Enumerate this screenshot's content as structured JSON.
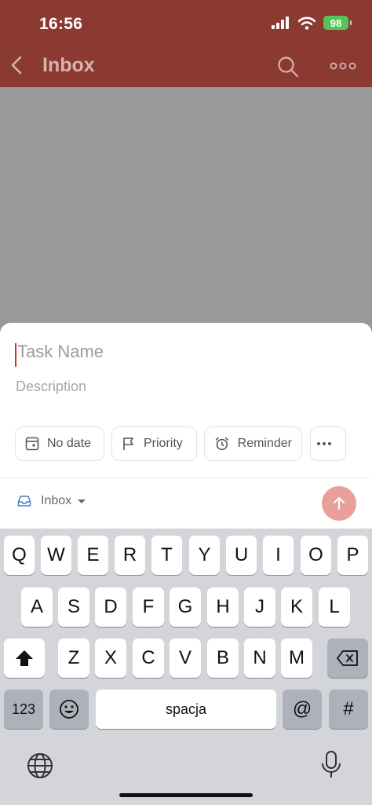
{
  "status": {
    "time": "16:56",
    "battery": "98"
  },
  "nav": {
    "title": "Inbox"
  },
  "task": {
    "name_placeholder": "Task Name",
    "description_placeholder": "Description"
  },
  "chips": {
    "date": "No date",
    "priority": "Priority",
    "reminder": "Reminder"
  },
  "project": {
    "label": "Inbox"
  },
  "keyboard": {
    "row1": [
      "Q",
      "W",
      "E",
      "R",
      "T",
      "Y",
      "U",
      "I",
      "O",
      "P"
    ],
    "row2": [
      "A",
      "S",
      "D",
      "F",
      "G",
      "H",
      "J",
      "K",
      "L"
    ],
    "row3": [
      "Z",
      "X",
      "C",
      "V",
      "B",
      "N",
      "M"
    ],
    "numbers_key": "123",
    "space_key": "spacja",
    "at_key": "@",
    "hash_key": "#"
  },
  "colors": {
    "header": "#8a3a31",
    "accent": "#c0392b",
    "submit": "#e9a09a"
  }
}
